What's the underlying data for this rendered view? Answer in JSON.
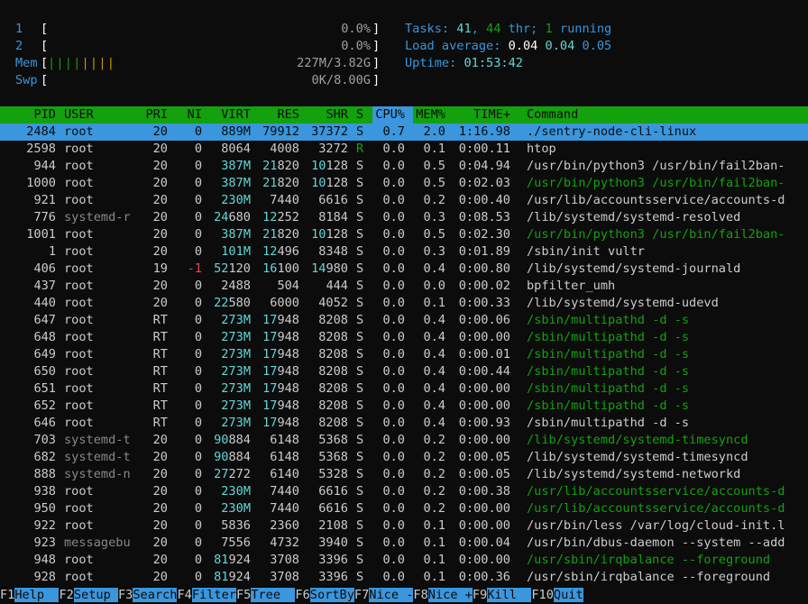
{
  "meters": {
    "cpu1": {
      "num": "1",
      "open": "[",
      "value": "0.0%",
      "close": "]"
    },
    "cpu2": {
      "num": "2",
      "open": "[",
      "value": "0.0%",
      "close": "]"
    },
    "mem": {
      "label": "Mem",
      "open": "[",
      "bars": "||||||||",
      "value": "227M/3.82G",
      "close": "]"
    },
    "swp": {
      "label": "Swp",
      "open": "[",
      "value": "0K/8.00G",
      "close": "]"
    }
  },
  "summary": {
    "tasks_label": "Tasks: ",
    "tasks": "41",
    "sep1": ", ",
    "threads": "44",
    "thr_label": " thr; ",
    "running": "1",
    "running_label": " running",
    "load_label": "Load average: ",
    "load1": "0.04",
    "load5": "0.04",
    "load15": "0.05",
    "uptime_label": "Uptime: ",
    "uptime": "01:53:42"
  },
  "columns": [
    "PID",
    "USER",
    "PRI",
    "NI",
    "VIRT",
    "RES",
    "SHR",
    "S",
    "CPU%",
    "MEM%",
    "TIME+",
    "Command"
  ],
  "processes": [
    {
      "pid": "2484",
      "user": "root",
      "pri": "20",
      "ni": "0",
      "virt": "889M",
      "res": "79912",
      "shr": "37372",
      "s": "S",
      "cpu": "0.7",
      "mem": "2.0",
      "time": "1:16.98",
      "cmd": "./sentry-node-cli-linux",
      "selected": true
    },
    {
      "pid": "2598",
      "user": "root",
      "pri": "20",
      "ni": "0",
      "virt": "8064",
      "res": "4008",
      "shr": "3272",
      "s": "R",
      "cpu": "0.0",
      "mem": "0.1",
      "time": "0:00.11",
      "cmd": "htop"
    },
    {
      "pid": "944",
      "user": "root",
      "pri": "20",
      "ni": "0",
      "virt": "387M",
      "res": "21820",
      "shr": "10128",
      "s": "S",
      "cpu": "0.0",
      "mem": "0.5",
      "time": "0:04.94",
      "cmd": "/usr/bin/python3 /usr/bin/fail2ban-"
    },
    {
      "pid": "1000",
      "user": "root",
      "pri": "20",
      "ni": "0",
      "virt": "387M",
      "res": "21820",
      "shr": "10128",
      "s": "S",
      "cpu": "0.0",
      "mem": "0.5",
      "time": "0:02.03",
      "cmd": "/usr/bin/python3 /usr/bin/fail2ban-",
      "thread": true
    },
    {
      "pid": "921",
      "user": "root",
      "pri": "20",
      "ni": "0",
      "virt": "230M",
      "res": "7440",
      "shr": "6616",
      "s": "S",
      "cpu": "0.0",
      "mem": "0.2",
      "time": "0:00.40",
      "cmd": "/usr/lib/accountsservice/accounts-d"
    },
    {
      "pid": "776",
      "user": "systemd-r",
      "pri": "20",
      "ni": "0",
      "virt": "24680",
      "res": "12252",
      "shr": "8184",
      "s": "S",
      "cpu": "0.0",
      "mem": "0.3",
      "time": "0:08.53",
      "cmd": "/lib/systemd/systemd-resolved"
    },
    {
      "pid": "1001",
      "user": "root",
      "pri": "20",
      "ni": "0",
      "virt": "387M",
      "res": "21820",
      "shr": "10128",
      "s": "S",
      "cpu": "0.0",
      "mem": "0.5",
      "time": "0:02.30",
      "cmd": "/usr/bin/python3 /usr/bin/fail2ban-",
      "thread": true
    },
    {
      "pid": "1",
      "user": "root",
      "pri": "20",
      "ni": "0",
      "virt": "101M",
      "res": "12496",
      "shr": "8348",
      "s": "S",
      "cpu": "0.0",
      "mem": "0.3",
      "time": "0:01.89",
      "cmd": "/sbin/init vultr"
    },
    {
      "pid": "406",
      "user": "root",
      "pri": "19",
      "ni": "-1",
      "virt": "52120",
      "res": "16100",
      "shr": "14980",
      "s": "S",
      "cpu": "0.0",
      "mem": "0.4",
      "time": "0:00.80",
      "cmd": "/lib/systemd/systemd-journald"
    },
    {
      "pid": "437",
      "user": "root",
      "pri": "20",
      "ni": "0",
      "virt": "2488",
      "res": "504",
      "shr": "444",
      "s": "S",
      "cpu": "0.0",
      "mem": "0.0",
      "time": "0:00.02",
      "cmd": "bpfilter_umh"
    },
    {
      "pid": "440",
      "user": "root",
      "pri": "20",
      "ni": "0",
      "virt": "22580",
      "res": "6000",
      "shr": "4052",
      "s": "S",
      "cpu": "0.0",
      "mem": "0.1",
      "time": "0:00.33",
      "cmd": "/lib/systemd/systemd-udevd"
    },
    {
      "pid": "647",
      "user": "root",
      "pri": "RT",
      "ni": "0",
      "virt": "273M",
      "res": "17948",
      "shr": "8208",
      "s": "S",
      "cpu": "0.0",
      "mem": "0.4",
      "time": "0:00.06",
      "cmd": "/sbin/multipathd -d -s",
      "thread": true
    },
    {
      "pid": "648",
      "user": "root",
      "pri": "RT",
      "ni": "0",
      "virt": "273M",
      "res": "17948",
      "shr": "8208",
      "s": "S",
      "cpu": "0.0",
      "mem": "0.4",
      "time": "0:00.00",
      "cmd": "/sbin/multipathd -d -s",
      "thread": true
    },
    {
      "pid": "649",
      "user": "root",
      "pri": "RT",
      "ni": "0",
      "virt": "273M",
      "res": "17948",
      "shr": "8208",
      "s": "S",
      "cpu": "0.0",
      "mem": "0.4",
      "time": "0:00.01",
      "cmd": "/sbin/multipathd -d -s",
      "thread": true
    },
    {
      "pid": "650",
      "user": "root",
      "pri": "RT",
      "ni": "0",
      "virt": "273M",
      "res": "17948",
      "shr": "8208",
      "s": "S",
      "cpu": "0.0",
      "mem": "0.4",
      "time": "0:00.44",
      "cmd": "/sbin/multipathd -d -s",
      "thread": true
    },
    {
      "pid": "651",
      "user": "root",
      "pri": "RT",
      "ni": "0",
      "virt": "273M",
      "res": "17948",
      "shr": "8208",
      "s": "S",
      "cpu": "0.0",
      "mem": "0.4",
      "time": "0:00.00",
      "cmd": "/sbin/multipathd -d -s",
      "thread": true
    },
    {
      "pid": "652",
      "user": "root",
      "pri": "RT",
      "ni": "0",
      "virt": "273M",
      "res": "17948",
      "shr": "8208",
      "s": "S",
      "cpu": "0.0",
      "mem": "0.4",
      "time": "0:00.00",
      "cmd": "/sbin/multipathd -d -s",
      "thread": true
    },
    {
      "pid": "646",
      "user": "root",
      "pri": "RT",
      "ni": "0",
      "virt": "273M",
      "res": "17948",
      "shr": "8208",
      "s": "S",
      "cpu": "0.0",
      "mem": "0.4",
      "time": "0:00.93",
      "cmd": "/sbin/multipathd -d -s"
    },
    {
      "pid": "703",
      "user": "systemd-t",
      "pri": "20",
      "ni": "0",
      "virt": "90884",
      "res": "6148",
      "shr": "5368",
      "s": "S",
      "cpu": "0.0",
      "mem": "0.2",
      "time": "0:00.00",
      "cmd": "/lib/systemd/systemd-timesyncd",
      "thread": true
    },
    {
      "pid": "682",
      "user": "systemd-t",
      "pri": "20",
      "ni": "0",
      "virt": "90884",
      "res": "6148",
      "shr": "5368",
      "s": "S",
      "cpu": "0.0",
      "mem": "0.2",
      "time": "0:00.05",
      "cmd": "/lib/systemd/systemd-timesyncd"
    },
    {
      "pid": "888",
      "user": "systemd-n",
      "pri": "20",
      "ni": "0",
      "virt": "27272",
      "res": "6140",
      "shr": "5328",
      "s": "S",
      "cpu": "0.0",
      "mem": "0.2",
      "time": "0:00.05",
      "cmd": "/lib/systemd/systemd-networkd"
    },
    {
      "pid": "938",
      "user": "root",
      "pri": "20",
      "ni": "0",
      "virt": "230M",
      "res": "7440",
      "shr": "6616",
      "s": "S",
      "cpu": "0.0",
      "mem": "0.2",
      "time": "0:00.38",
      "cmd": "/usr/lib/accountsservice/accounts-d",
      "thread": true
    },
    {
      "pid": "950",
      "user": "root",
      "pri": "20",
      "ni": "0",
      "virt": "230M",
      "res": "7440",
      "shr": "6616",
      "s": "S",
      "cpu": "0.0",
      "mem": "0.2",
      "time": "0:00.00",
      "cmd": "/usr/lib/accountsservice/accounts-d",
      "thread": true
    },
    {
      "pid": "922",
      "user": "root",
      "pri": "20",
      "ni": "0",
      "virt": "5836",
      "res": "2360",
      "shr": "2108",
      "s": "S",
      "cpu": "0.0",
      "mem": "0.1",
      "time": "0:00.00",
      "cmd": "/usr/bin/less /var/log/cloud-init.l"
    },
    {
      "pid": "923",
      "user": "messagebu",
      "pri": "20",
      "ni": "0",
      "virt": "7556",
      "res": "4732",
      "shr": "3940",
      "s": "S",
      "cpu": "0.0",
      "mem": "0.1",
      "time": "0:00.04",
      "cmd": "/usr/bin/dbus-daemon --system --add"
    },
    {
      "pid": "948",
      "user": "root",
      "pri": "20",
      "ni": "0",
      "virt": "81924",
      "res": "3708",
      "shr": "3396",
      "s": "S",
      "cpu": "0.0",
      "mem": "0.1",
      "time": "0:00.00",
      "cmd": "/usr/sbin/irqbalance --foreground",
      "thread": true
    },
    {
      "pid": "928",
      "user": "root",
      "pri": "20",
      "ni": "0",
      "virt": "81924",
      "res": "3708",
      "shr": "3396",
      "s": "S",
      "cpu": "0.0",
      "mem": "0.1",
      "time": "0:00.36",
      "cmd": "/usr/sbin/irqbalance --foreground"
    }
  ],
  "function_keys": [
    {
      "key": "F1",
      "label": "Help  "
    },
    {
      "key": "F2",
      "label": "Setup "
    },
    {
      "key": "F3",
      "label": "Search"
    },
    {
      "key": "F4",
      "label": "Filter"
    },
    {
      "key": "F5",
      "label": "Tree  "
    },
    {
      "key": "F6",
      "label": "SortBy"
    },
    {
      "key": "F7",
      "label": "Nice -"
    },
    {
      "key": "F8",
      "label": "Nice +"
    },
    {
      "key": "F9",
      "label": "Kill  "
    },
    {
      "key": "F10",
      "label": "Quit"
    }
  ],
  "colors": {
    "background": "#0c0c0c",
    "header_bg": "#13a10e",
    "selected_bg": "#3a96dd",
    "blue": "#3a96dd",
    "cyan": "#61d6d6",
    "green": "#13a10e",
    "yellow": "#c19c00",
    "red": "#e74856"
  }
}
